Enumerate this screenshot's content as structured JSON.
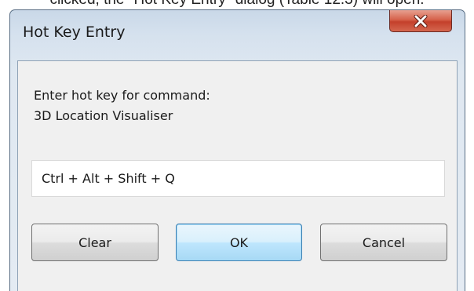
{
  "background_caption": "clicked, the \"Hot Key Entry\" dialog (Table 12.3) will open.",
  "dialog": {
    "title": "Hot Key Entry",
    "prompt_line1": "Enter hot key for command:",
    "prompt_line2": "3D Location Visualiser",
    "hotkey_value": "Ctrl + Alt + Shift + Q",
    "buttons": {
      "clear": "Clear",
      "ok": "OK",
      "cancel": "Cancel"
    }
  },
  "icons": {
    "close": "close-icon"
  },
  "colors": {
    "close_button": "#c4402b",
    "default_button_border": "#3c7fb1",
    "frame": "#d5e1ee"
  }
}
